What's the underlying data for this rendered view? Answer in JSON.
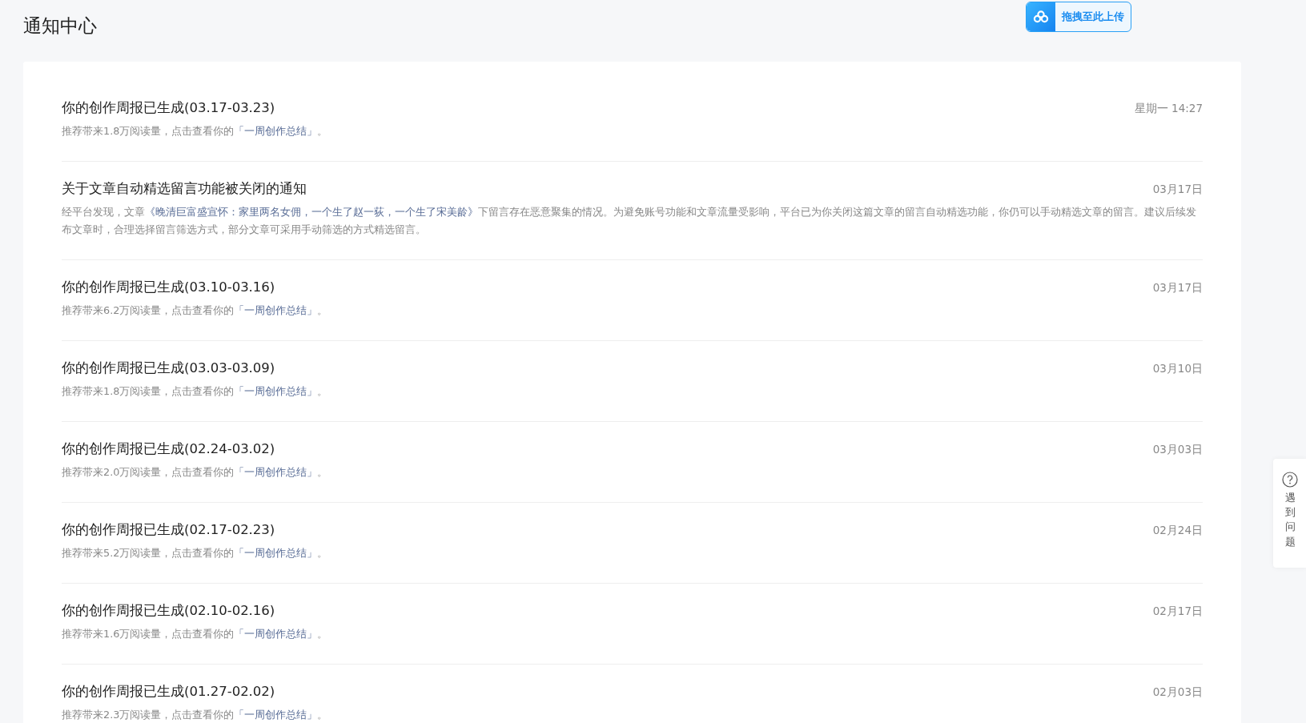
{
  "page_title": "通知中心",
  "upload_button": {
    "label": "拖拽至此上传"
  },
  "notifications": [
    {
      "title": "你的创作周报已生成(03.17-03.23)",
      "time": "星期一 14:27",
      "description": [
        {
          "kind": "text",
          "text": "推荐带来1.8万阅读量，点击查看你的"
        },
        {
          "kind": "link",
          "text": "「一周创作总结」"
        },
        {
          "kind": "text",
          "text": "。"
        }
      ]
    },
    {
      "title": "关于文章自动精选留言功能被关闭的通知",
      "time": "03月17日",
      "description": [
        {
          "kind": "text",
          "text": "经平台发现，文章"
        },
        {
          "kind": "link",
          "text": "《晚清巨富盛宣怀：家里两名女佣，一个生了赵一荻，一个生了宋美龄》"
        },
        {
          "kind": "text",
          "text": "下留言存在恶意聚集的情况。为避免账号功能和文章流量受影响，平台已为你关闭这篇文章的留言自动精选功能，你仍可以手动精选文章的留言。建议后续发布文章时，合理选择留言筛选方式，部分文章可采用手动筛选的方式精选留言。"
        }
      ]
    },
    {
      "title": "你的创作周报已生成(03.10-03.16)",
      "time": "03月17日",
      "description": [
        {
          "kind": "text",
          "text": "推荐带来6.2万阅读量，点击查看你的"
        },
        {
          "kind": "link",
          "text": "「一周创作总结」"
        },
        {
          "kind": "text",
          "text": "。"
        }
      ]
    },
    {
      "title": "你的创作周报已生成(03.03-03.09)",
      "time": "03月10日",
      "description": [
        {
          "kind": "text",
          "text": "推荐带来1.8万阅读量，点击查看你的"
        },
        {
          "kind": "link",
          "text": "「一周创作总结」"
        },
        {
          "kind": "text",
          "text": "。"
        }
      ]
    },
    {
      "title": "你的创作周报已生成(02.24-03.02)",
      "time": "03月03日",
      "description": [
        {
          "kind": "text",
          "text": "推荐带来2.0万阅读量，点击查看你的"
        },
        {
          "kind": "link",
          "text": "「一周创作总结」"
        },
        {
          "kind": "text",
          "text": "。"
        }
      ]
    },
    {
      "title": "你的创作周报已生成(02.17-02.23)",
      "time": "02月24日",
      "description": [
        {
          "kind": "text",
          "text": "推荐带来5.2万阅读量，点击查看你的"
        },
        {
          "kind": "link",
          "text": "「一周创作总结」"
        },
        {
          "kind": "text",
          "text": "。"
        }
      ]
    },
    {
      "title": "你的创作周报已生成(02.10-02.16)",
      "time": "02月17日",
      "description": [
        {
          "kind": "text",
          "text": "推荐带来1.6万阅读量，点击查看你的"
        },
        {
          "kind": "link",
          "text": "「一周创作总结」"
        },
        {
          "kind": "text",
          "text": "。"
        }
      ]
    },
    {
      "title": "你的创作周报已生成(01.27-02.02)",
      "time": "02月03日",
      "description": [
        {
          "kind": "text",
          "text": "推荐带来2.3万阅读量，点击查看你的"
        },
        {
          "kind": "link",
          "text": "「一周创作总结」"
        },
        {
          "kind": "text",
          "text": "。"
        }
      ]
    }
  ],
  "help_tab": {
    "label": "遇到问题"
  }
}
